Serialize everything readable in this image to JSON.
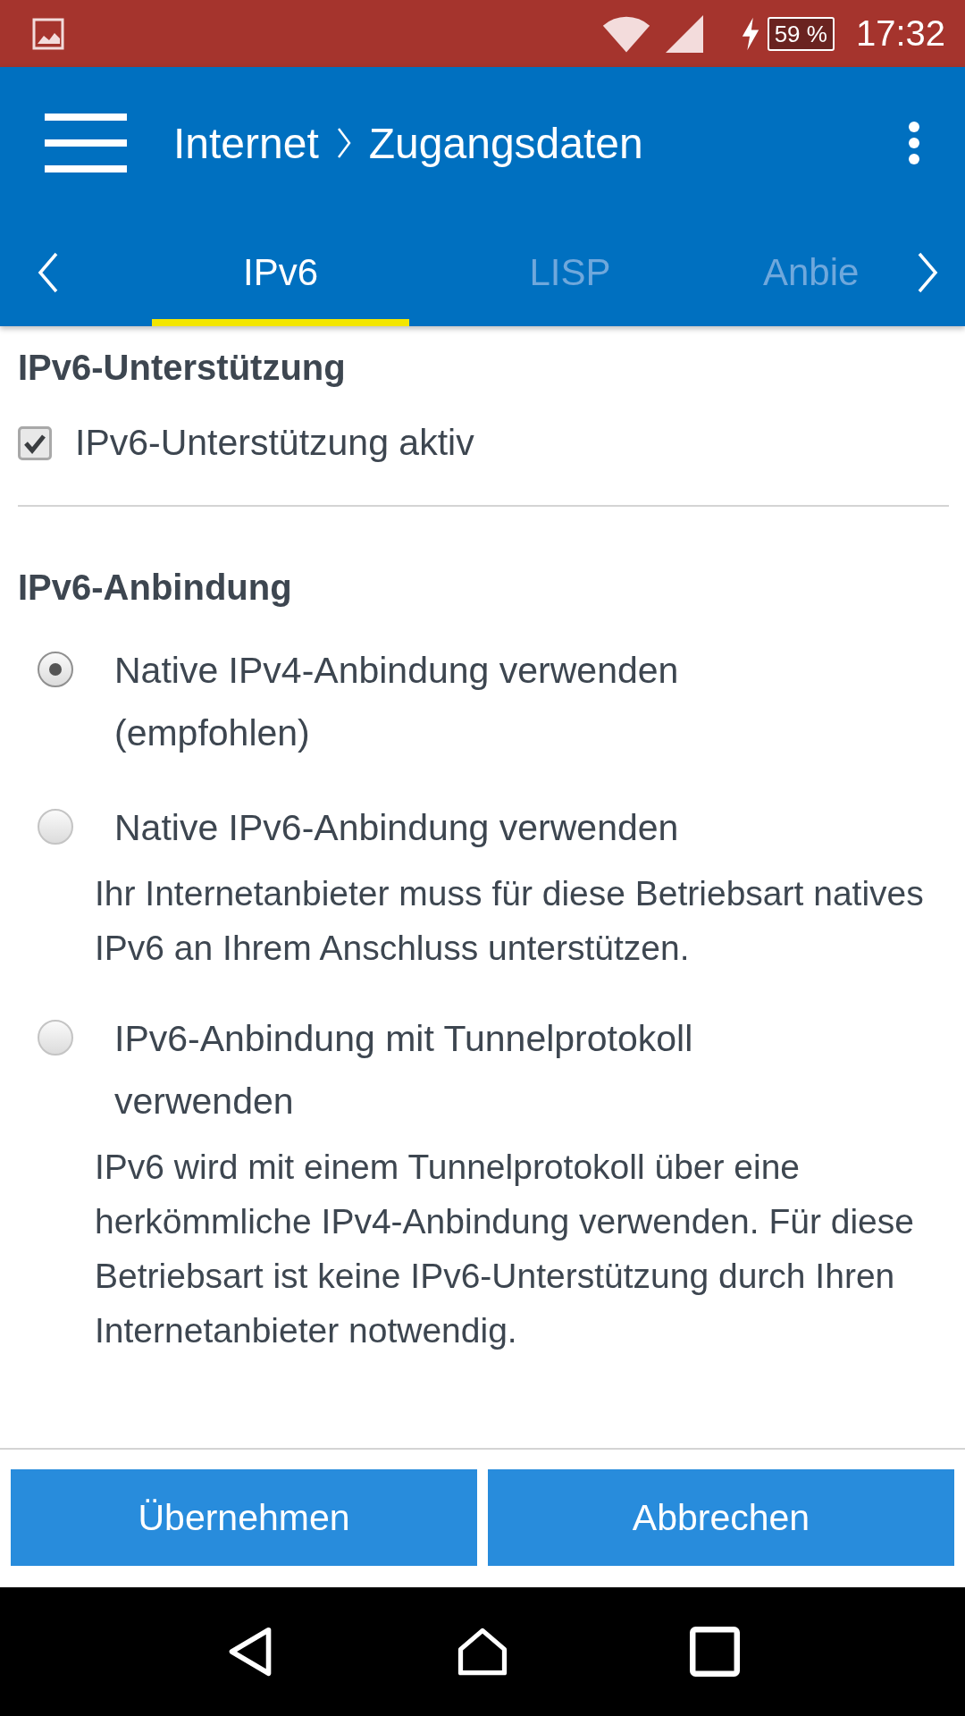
{
  "status_bar": {
    "battery": "59 %",
    "time": "17:32"
  },
  "app_bar": {
    "breadcrumb": [
      "Internet",
      "Zugangsdaten"
    ]
  },
  "tabs": [
    {
      "label": "IPv6",
      "selected": true
    },
    {
      "label": "LISP",
      "selected": false
    },
    {
      "label": "Anbie",
      "selected": false
    }
  ],
  "sections": [
    {
      "title": "IPv6-Unterstützung",
      "options": [
        {
          "kind": "checkbox",
          "label": "IPv6-Unterstützung aktiv",
          "checked": true
        }
      ]
    },
    {
      "title": "IPv6-Anbindung",
      "options": [
        {
          "kind": "radio",
          "label": "Native IPv4-Anbindung verwenden (empfohlen)",
          "selected": true
        },
        {
          "kind": "radio",
          "label": "Native IPv6-Anbindung verwenden",
          "selected": false,
          "description": "Ihr Internetanbieter muss für diese Betriebsart natives IPv6 an Ihrem Anschluss unterstützen."
        },
        {
          "kind": "radio",
          "label": "IPv6-Anbindung mit Tunnelprotokoll verwenden",
          "selected": false,
          "description": "IPv6 wird mit einem Tunnelprotokoll über eine herkömmliche IPv4-Anbindung verwenden. Für diese Betriebsart ist keine IPv6-Unterstützung durch Ihren Internetanbieter notwendig."
        }
      ]
    }
  ],
  "buttons": [
    "Übernehmen",
    "Abbrechen"
  ]
}
